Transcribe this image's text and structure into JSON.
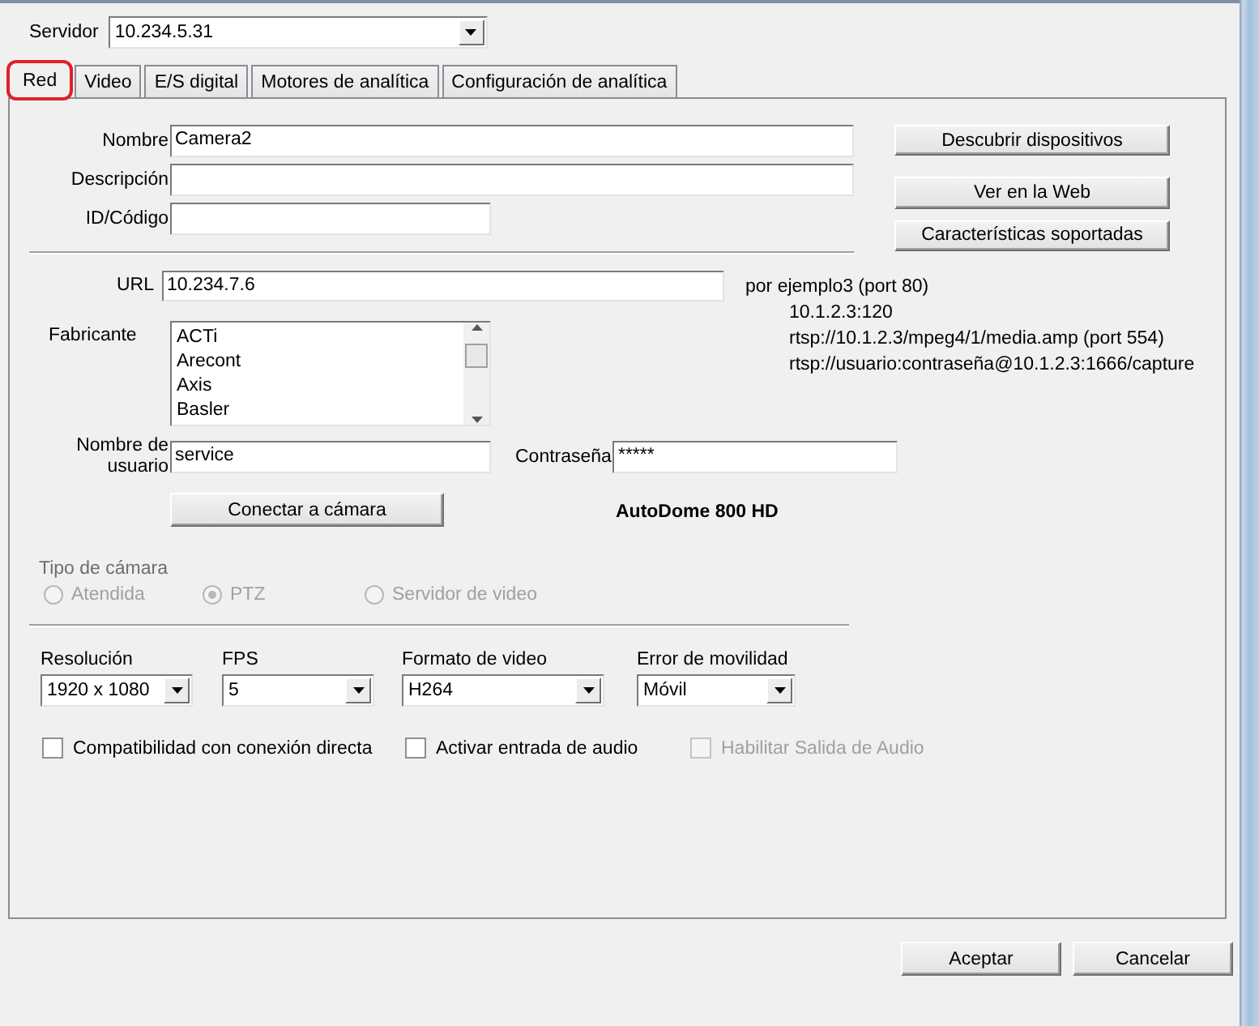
{
  "server": {
    "label": "Servidor",
    "value": "10.234.5.31"
  },
  "tabs": [
    {
      "label": "Red",
      "selected": true,
      "highlighted": true
    },
    {
      "label": "Video",
      "selected": false,
      "highlighted": false
    },
    {
      "label": "E/S digital",
      "selected": false,
      "highlighted": false
    },
    {
      "label": "Motores de analítica",
      "selected": false,
      "highlighted": false
    },
    {
      "label": "Configuración de analítica",
      "selected": false,
      "highlighted": false
    }
  ],
  "fields": [
    {
      "label": "Nombre",
      "value": "Camera2"
    },
    {
      "label": "Descripción"
    },
    {
      "label": "ID/Código"
    }
  ],
  "side_buttons": [
    "Descubrir dispositivos",
    "Ver en la Web",
    "Características soportadas"
  ],
  "url": {
    "label": "URL",
    "value": "10.234.7.6",
    "examples": [
      "por ejemplo3 (port 80)",
      "10.1.2.3:120",
      "rtsp://10.1.2.3/mpeg4/1/media.amp (port 554)",
      "rtsp://usuario:contraseña@10.1.2.3:1666/capture"
    ]
  },
  "manufacturer": {
    "label": "Fabricante",
    "items": [
      "ACTi",
      "Arecont",
      "Axis",
      "Basler"
    ]
  },
  "username": {
    "label": "Nombre de usuario",
    "value": "service"
  },
  "password": {
    "label": "Contraseña",
    "value": "*****"
  },
  "connect_button": "Conectar a cámara",
  "model": "AutoDome 800 HD",
  "camera_type": {
    "label": "Tipo de cámara",
    "disabled": true,
    "options": [
      {
        "label": "Atendida",
        "selected": false
      },
      {
        "label": "PTZ",
        "selected": true
      },
      {
        "label": "Servidor de video",
        "selected": false
      }
    ]
  },
  "dropdowns": [
    {
      "label": "Resolución",
      "value": "1920 x 1080"
    },
    {
      "label": "FPS",
      "value": "5"
    },
    {
      "label": "Formato de video",
      "value": "H264"
    },
    {
      "label": "Error de movilidad",
      "value": "Móvil"
    }
  ],
  "checkboxes": [
    {
      "label": "Compatibilidad con conexión directa",
      "checked": false,
      "disabled": false
    },
    {
      "label": "Activar entrada de audio",
      "checked": false,
      "disabled": false
    },
    {
      "label": "Habilitar Salida de Audio",
      "checked": false,
      "disabled": true
    }
  ],
  "footer_buttons": [
    "Aceptar",
    "Cancelar"
  ]
}
